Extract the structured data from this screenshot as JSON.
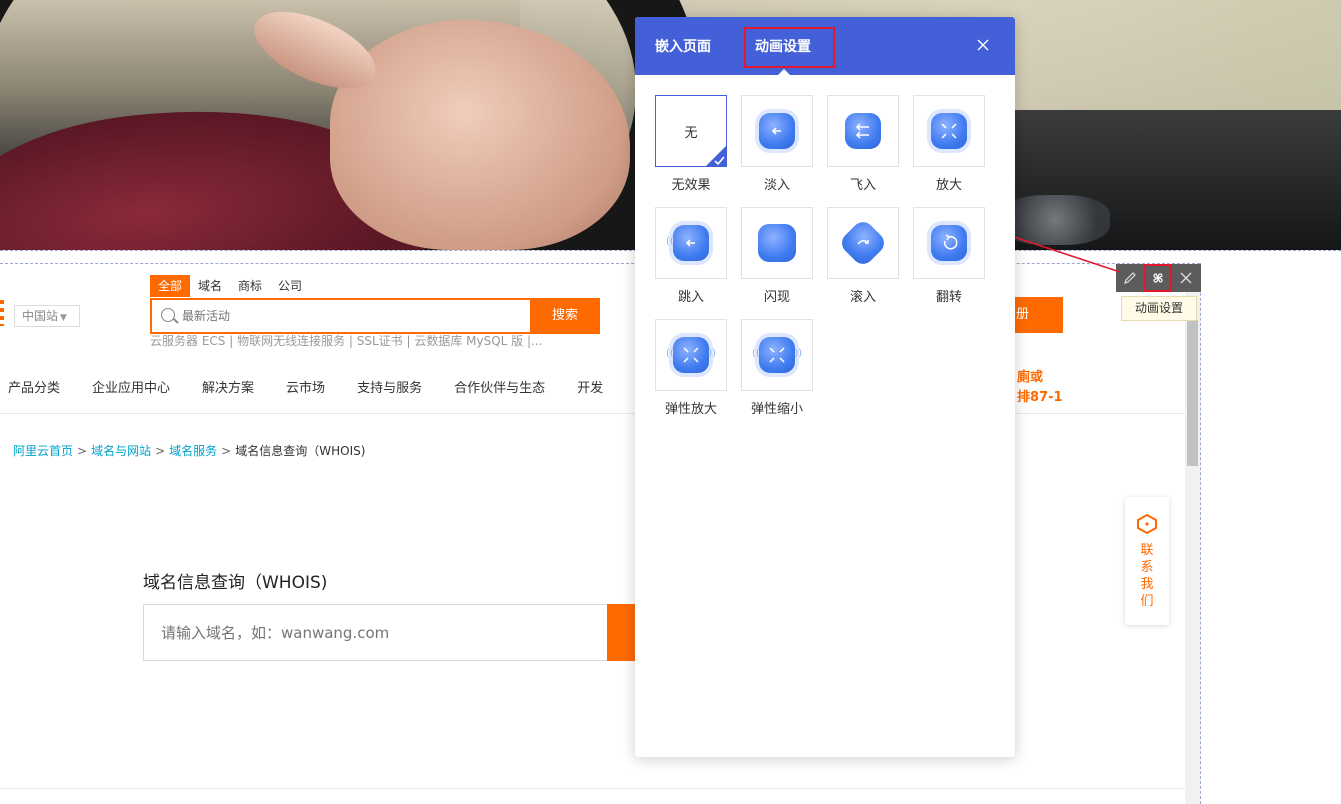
{
  "header": {
    "site_select": "中国站",
    "search_tabs": [
      "全部",
      "域名",
      "商标",
      "公司"
    ],
    "search_placeholder": "最新活动",
    "search_button": "搜索",
    "hot_links": "云服务器 ECS | 物联网无线连接服务 | SSL证书 | 云数据库 MySQL 版 |...",
    "register_label": "册"
  },
  "nav": {
    "items": [
      "产品分类",
      "企业应用中心",
      "解决方案",
      "云市场",
      "支持与服务",
      "合作伙伴与生态",
      "开发"
    ],
    "promo_line1": "廁或",
    "promo_line2": "排87-1"
  },
  "breadcrumb": {
    "items": [
      "阿里云首页",
      "域名与网站",
      "域名服务"
    ],
    "current": "域名信息查询（WHOIS)",
    "separator": ">"
  },
  "whois": {
    "title": "域名信息查询（WHOIS)",
    "placeholder": "请输入域名，如：wanwang.com"
  },
  "contact": {
    "label": "联系我们"
  },
  "toolbar": {
    "tooltip": "动画设置"
  },
  "modal": {
    "tabs": [
      "嵌入页面",
      "动画设置"
    ],
    "active_tab": "动画设置",
    "effects": [
      {
        "label": "无效果",
        "tile_text": "无",
        "selected": true
      },
      {
        "label": "淡入"
      },
      {
        "label": "飞入"
      },
      {
        "label": "放大"
      },
      {
        "label": "跳入"
      },
      {
        "label": "闪现"
      },
      {
        "label": "滚入"
      },
      {
        "label": "翻转"
      },
      {
        "label": "弹性放大"
      },
      {
        "label": "弹性缩小"
      }
    ]
  },
  "colors": {
    "accent": "#ff6a00",
    "modal_header": "#4460d8",
    "highlight": "#e0192c",
    "link": "#00a2ca"
  }
}
